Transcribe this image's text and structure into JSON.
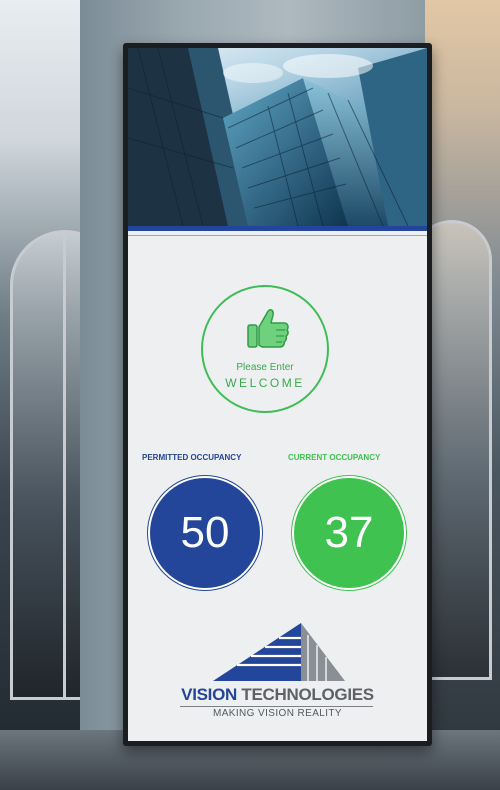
{
  "sign": {
    "entry_prompt": "Please Enter",
    "welcome": "WELCOME"
  },
  "occupancy": {
    "permitted_label_prefix": "PERMITTED ",
    "permitted_label_suffix": "OCCUPANCY",
    "permitted_value": "50",
    "current_label_prefix": "CURRENT ",
    "current_label_suffix": "OCCUPANCY",
    "current_value": "37"
  },
  "brand": {
    "name_part1": "VISION",
    "name_part2": " TECHNOLOGIES",
    "tagline": "MAKING VISION REALITY"
  },
  "colors": {
    "primary_blue": "#23459a",
    "accent_green": "#3fc250",
    "panel_bg": "#eeeff0"
  },
  "icons": {
    "welcome": "thumbs-up-icon",
    "logo": "vision-technologies-logo"
  }
}
